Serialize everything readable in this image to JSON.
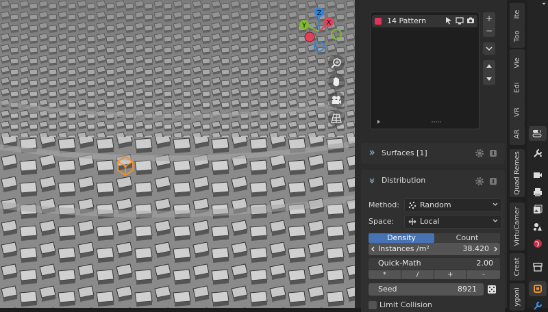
{
  "list": {
    "items": [
      {
        "label": "14 Pattern",
        "color": "#e0325a"
      }
    ],
    "buttons": {
      "add": "+",
      "remove": "−"
    }
  },
  "sections": {
    "surfaces": {
      "title": "Surfaces [1]"
    },
    "distribution": {
      "title": "Distribution"
    }
  },
  "distribution": {
    "method_label": "Method:",
    "method_value": "Random",
    "space_label": "Space:",
    "space_value": "Local",
    "tabs": [
      "Density",
      "Count"
    ],
    "active_tab": "Density",
    "instances_label": "Instances /m²",
    "instances_value": "38.420",
    "quick_math_label": "Quick-Math",
    "quick_math_value": "2.00",
    "operators": [
      "*",
      "/",
      "+",
      "-"
    ],
    "seed_label": "Seed",
    "seed_value": "8921",
    "limit_collision_label": "Limit Collision"
  },
  "gizmo": {
    "z": "Z",
    "y": "Y",
    "x": "X"
  },
  "side_tabs": [
    "Ite",
    "Too",
    "Vie",
    "Edi",
    "VR",
    "AR",
    "Quad Remes",
    "VirtuCamer",
    "Creat",
    "ygoni"
  ],
  "colors": {
    "accent": "#4772b3",
    "selection": "#f0902a",
    "x_axis": "#e0425a",
    "y_axis": "#7fbb2d",
    "z_axis": "#2b86e3"
  }
}
